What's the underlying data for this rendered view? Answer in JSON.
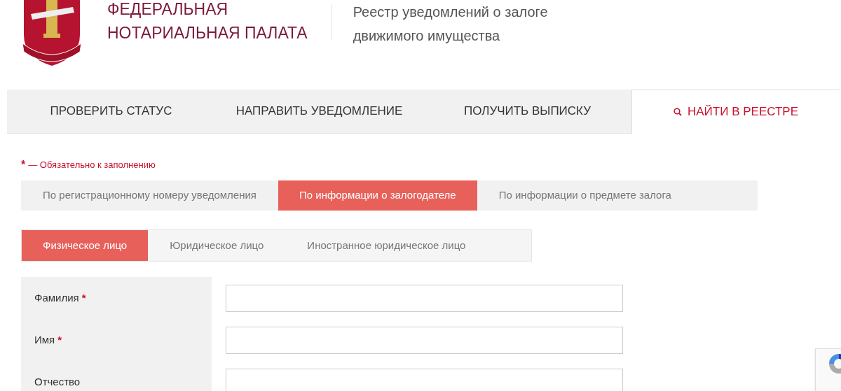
{
  "header": {
    "org_name_line1": "ФЕДЕРАЛЬНАЯ",
    "org_name_line2": "НОТАРИАЛЬНАЯ ПАЛАТА",
    "subtitle_line1": "Реестр уведомлений о залоге",
    "subtitle_line2": "движимого имущества"
  },
  "main_nav": [
    {
      "label": "ПРОВЕРИТЬ СТАТУС",
      "selected": false
    },
    {
      "label": "НАПРАВИТЬ УВЕДОМЛЕНИЕ",
      "selected": false
    },
    {
      "label": "ПОЛУЧИТЬ ВЫПИСКУ",
      "selected": false
    },
    {
      "label": "НАЙТИ В РЕЕСТРЕ",
      "selected": true
    }
  ],
  "required_note": {
    "mark": "*",
    "text": "— Обязательно к заполнению"
  },
  "search_tabs": [
    {
      "label": "По регистрационному номеру уведомления",
      "selected": false
    },
    {
      "label": "По информации о залогодателе",
      "selected": true
    },
    {
      "label": "По информации о предмете залога",
      "selected": false
    }
  ],
  "person_tabs": [
    {
      "label": "Физическое лицо",
      "selected": true
    },
    {
      "label": "Юридическое лицо",
      "selected": false
    },
    {
      "label": "Иностранное юридическое лицо",
      "selected": false
    }
  ],
  "fields": [
    {
      "label": "Фамилия",
      "mark": "*"
    },
    {
      "label": "Имя",
      "mark": "*"
    },
    {
      "label": "Отчество"
    }
  ]
}
